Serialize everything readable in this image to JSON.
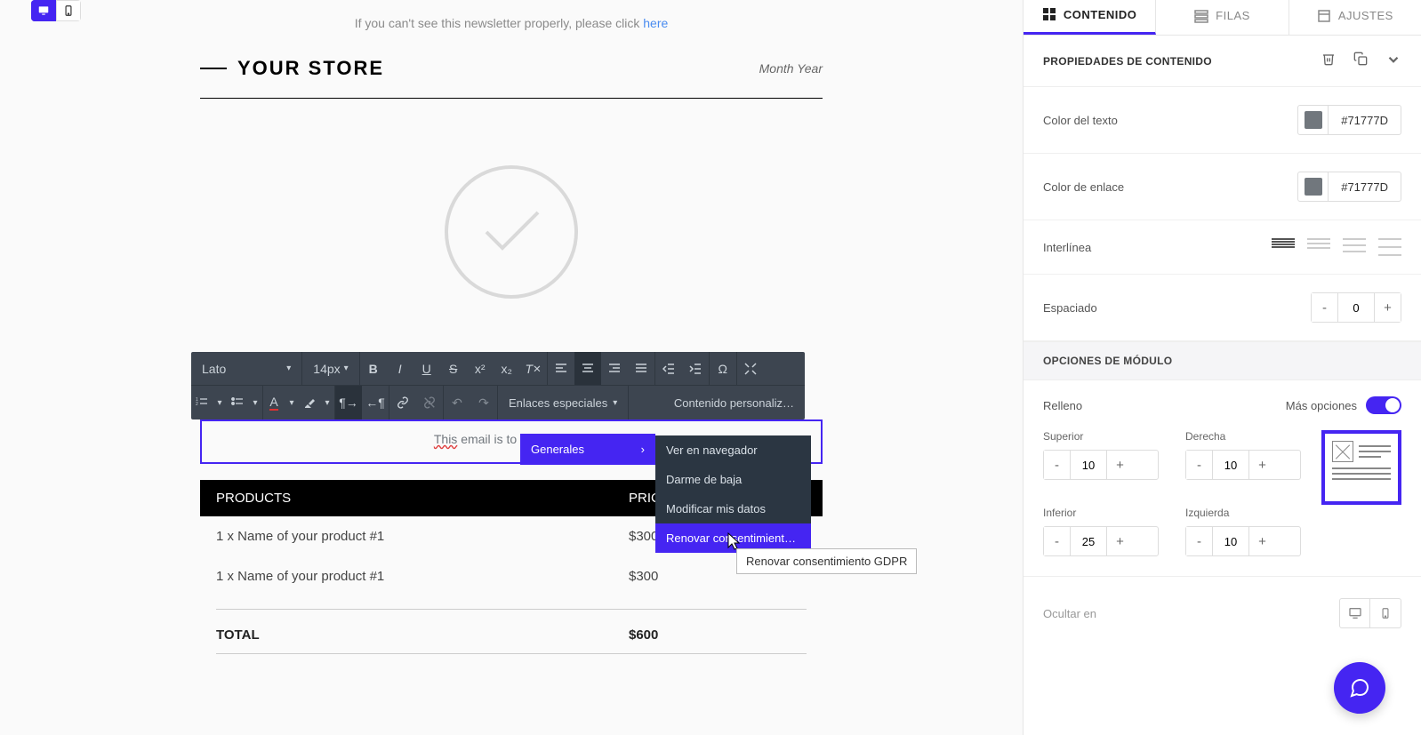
{
  "canvas": {
    "preview_prefix": "If you can't see this newsletter properly, please click ",
    "preview_link": "here",
    "store_name": "YOUR STORE",
    "month_year": "Month Year",
    "confirm_text_underlined": "This",
    "confirm_text_rest": " email is to confirm your ",
    "products_header_left": "PRODUCTS",
    "products_header_right": "PRICE",
    "products": [
      {
        "name": "1 x Name of your product #1",
        "price": "$300"
      },
      {
        "name": "1 x Name of your product #1",
        "price": "$300"
      }
    ],
    "total_label": "TOTAL",
    "total_value": "$600"
  },
  "toolbar": {
    "font": "Lato",
    "size": "14px",
    "special_links": "Enlaces especiales",
    "custom_content": "Contenido personaliz…"
  },
  "menus": {
    "generales": "Generales",
    "submenu": [
      "Ver en navegador",
      "Darme de baja",
      "Modificar mis datos",
      "Renovar consentimiento G…"
    ],
    "tooltip": "Renovar consentimiento GDPR"
  },
  "sidebar": {
    "tabs": {
      "contenido": "CONTENIDO",
      "filas": "FILAS",
      "ajustes": "AJUSTES"
    },
    "section_title": "PROPIEDADES DE CONTENIDO",
    "text_color_label": "Color del texto",
    "text_color_value": "#71777D",
    "link_color_label": "Color de enlace",
    "link_color_value": "#71777D",
    "lineheight_label": "Interlínea",
    "spacing_label": "Espaciado",
    "spacing_value": "0",
    "module_title": "OPCIONES DE MÓDULO",
    "relleno_label": "Relleno",
    "more_options": "Más opciones",
    "padding": {
      "superior_label": "Superior",
      "superior": "10",
      "derecha_label": "Derecha",
      "derecha": "10",
      "inferior_label": "Inferior",
      "inferior": "25",
      "izquierda_label": "Izquierda",
      "izquierda": "10"
    },
    "ocultar_label": "Ocultar en"
  }
}
